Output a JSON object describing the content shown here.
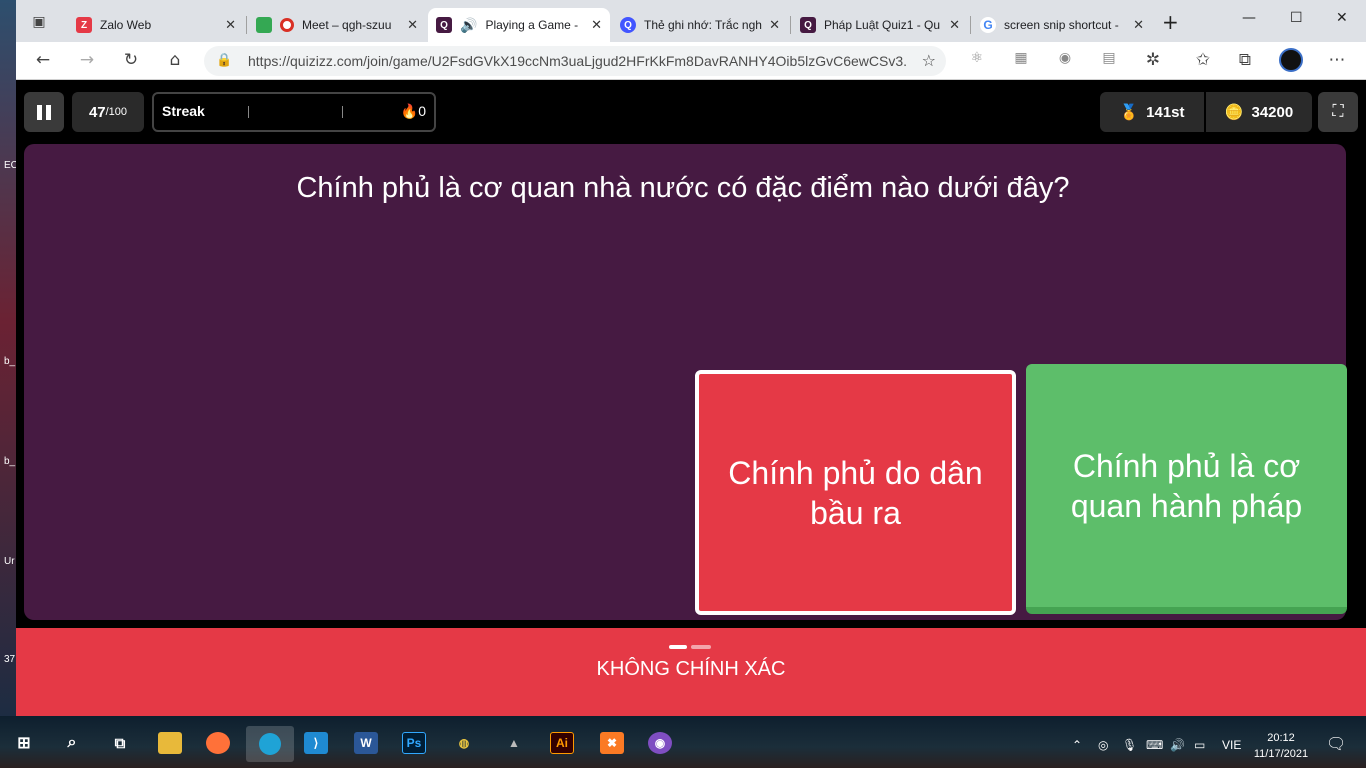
{
  "desktop": {
    "labels": [
      "EC",
      "b_",
      "b_",
      "Ur",
      "37"
    ]
  },
  "browser": {
    "tabs": [
      {
        "title": "Zalo Web",
        "icon": "zalo-icon",
        "color": "#e53946"
      },
      {
        "title": "Meet – qgh-szuu",
        "icon": "meet-icon",
        "color": "#ffffff"
      },
      {
        "title": "Playing a Game -",
        "icon": "quizizz-icon",
        "color": "#461a42",
        "active": true
      },
      {
        "title": "Thẻ ghi nhớ: Trắc ngh",
        "icon": "quizlet-icon",
        "color": "#4255ff"
      },
      {
        "title": "Pháp Luật Quiz1 - Qu",
        "icon": "quizizz-icon",
        "color": "#461a42"
      },
      {
        "title": "screen snip shortcut -",
        "icon": "google-icon",
        "color": "#ffffff"
      }
    ],
    "new_tab": "+",
    "url": "https://quizizz.com/join/game/U2FsdGVkX19ccNm3uaLjgud2HFrKkFm8DavRANHY4Oib5lzGvC6ewCSv3..."
  },
  "game": {
    "question_number": "47",
    "question_total": "/100",
    "streak_label": "Streak",
    "streak_count": "0",
    "rank": "141st",
    "coins": "34200",
    "question": "Chính phủ là cơ quan nhà nước có đặc điểm nào dưới đây?",
    "options": [
      {
        "text": "Chính phủ do dân bầu ra",
        "color": "#e53946",
        "selected": true
      },
      {
        "text": "Chính phủ là cơ quan hành pháp",
        "color": "#5dbe6a",
        "correct": true
      }
    ],
    "feedback": "KHÔNG CHÍNH XÁC",
    "feedback_color": "#e53946"
  },
  "taskbar": {
    "apps": [
      "start-icon",
      "search-icon",
      "task-view-icon",
      "file-explorer-icon",
      "firefox-icon",
      "edge-icon",
      "vscode-icon",
      "word-icon",
      "photoshop-icon",
      "corel-icon",
      "inkscape-icon",
      "illustrator-icon",
      "xampp-icon",
      "github-icon"
    ],
    "language": "VIE",
    "time": "20:12",
    "date": "11/17/2021"
  }
}
